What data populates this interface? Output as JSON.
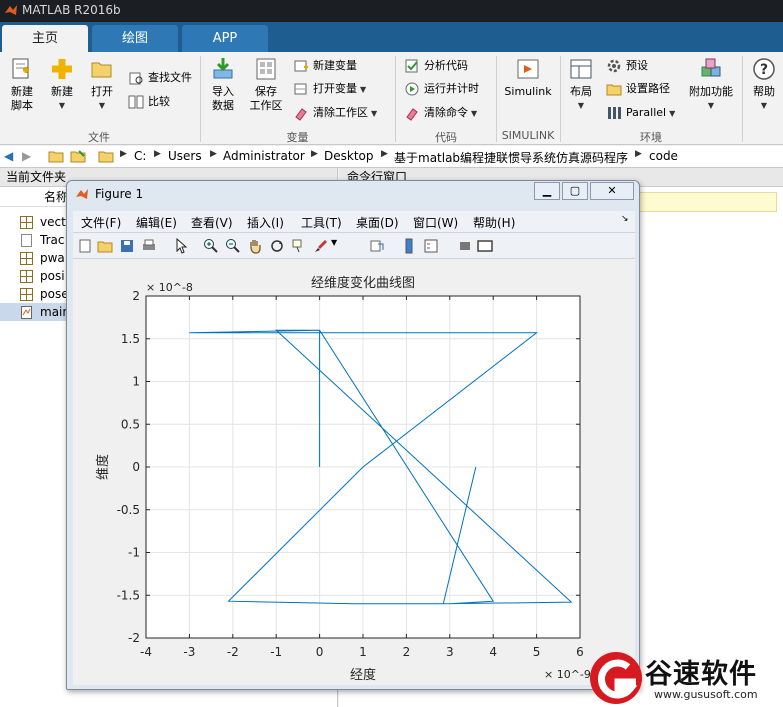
{
  "app": {
    "title": "MATLAB R2016b"
  },
  "tabs": [
    {
      "label": "主页"
    },
    {
      "label": "绘图"
    },
    {
      "label": "APP"
    }
  ],
  "ribbon": {
    "new_script": "新建\n脚本",
    "new": "新建",
    "open": "打开",
    "find_files": "查找文件",
    "compare": "比较",
    "group_file": "文件",
    "import": "导入\n数据",
    "save_ws": "保存\n工作区",
    "new_var": "新建变量",
    "open_var": "打开变量",
    "clear_ws": "清除工作区",
    "group_var": "变量",
    "analyze": "分析代码",
    "run_time": "运行并计时",
    "clear_cmd": "清除命令",
    "group_code": "代码",
    "simulink": "Simulink",
    "group_simulink": "SIMULINK",
    "layout": "布局",
    "prefs": "预设",
    "set_path": "设置路径",
    "parallel": "Parallel",
    "group_env": "环境",
    "addons": "附加功能",
    "help": "帮助"
  },
  "address": {
    "crumbs": [
      "C:",
      "Users",
      "Administrator",
      "Desktop",
      "基于matlab编程捷联惯导系统仿真源码程序",
      "code"
    ]
  },
  "left_panel": {
    "title": "当前文件夹",
    "column_name": "名称",
    "files": [
      {
        "name": "vecto",
        "type": "data"
      },
      {
        "name": "Trac",
        "type": "doc"
      },
      {
        "name": "pwa",
        "type": "data"
      },
      {
        "name": "posi",
        "type": "data"
      },
      {
        "name": "pose",
        "type": "data"
      },
      {
        "name": "main",
        "type": "script",
        "selected": true
      }
    ]
  },
  "right_panel": {
    "title": "命令行窗口"
  },
  "figure": {
    "title": "Figure 1",
    "menus": [
      "文件(F)",
      "编辑(E)",
      "查看(V)",
      "插入(I)",
      "工具(T)",
      "桌面(D)",
      "窗口(W)",
      "帮助(H)"
    ]
  },
  "chart_data": {
    "type": "line",
    "title": "经维度变化曲线图",
    "xlabel": "经度",
    "ylabel": "维度",
    "x_exponent": "× 10^-9",
    "y_exponent": "× 10^-8",
    "xlim": [
      -4,
      6
    ],
    "ylim": [
      -2,
      2
    ],
    "xticks": [
      -4,
      -3,
      -2,
      -1,
      0,
      1,
      2,
      3,
      4,
      5,
      6
    ],
    "yticks": [
      -2,
      -1.5,
      -1,
      -0.5,
      0,
      0.5,
      1,
      1.5,
      2
    ],
    "grid": true,
    "color": "#0072bd",
    "x": [
      0,
      0,
      -1,
      5.8,
      2.85,
      3.6,
      3.6,
      2.85,
      2.0,
      0.8,
      -2.1,
      1.0,
      5.0,
      -3.0,
      0,
      4.0,
      3.0
    ],
    "y": [
      0,
      1.6,
      1.6,
      -1.58,
      -1.6,
      0,
      0,
      -1.6,
      -1.6,
      -1.6,
      -1.57,
      0,
      1.57,
      1.57,
      1.6,
      -1.57,
      -1.6
    ]
  },
  "watermark": {
    "brand": "谷速软件",
    "url": "www.gususoft.com"
  }
}
